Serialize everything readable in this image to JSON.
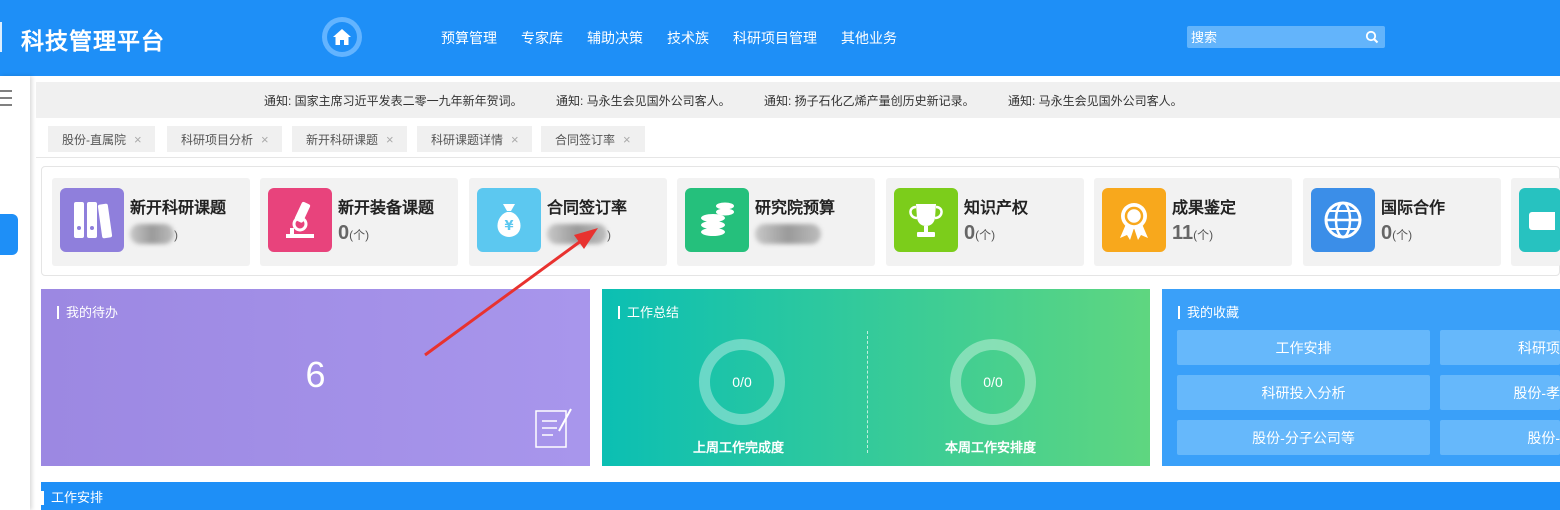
{
  "header": {
    "app_title": "科技管理平台",
    "nav": [
      "预算管理",
      "专家库",
      "辅助决策",
      "技术族",
      "科研项目管理",
      "其他业务"
    ],
    "search_placeholder": "搜索"
  },
  "notices": [
    "通知: 国家主席习近平发表二零一九年新年贺词。",
    "通知: 马永生会见国外公司客人。",
    "通知: 扬子石化乙烯产量创历史新记录。",
    "通知: 马永生会见国外公司客人。"
  ],
  "tabs": [
    "股份-直属院",
    "科研项目分析",
    "新开科研课题",
    "科研课题详情",
    "合同签订率"
  ],
  "modules": [
    {
      "title": "新开科研课题",
      "count": "",
      "unit": ")",
      "icon": "binders-icon",
      "color": "#8f7fdc"
    },
    {
      "title": "新开装备课题",
      "count": "0",
      "unit": "(个)",
      "icon": "microscope-icon",
      "color": "#e8437c"
    },
    {
      "title": "合同签订率",
      "count": "",
      "unit": ")",
      "icon": "money-bag-icon",
      "color": "#5cc8f0"
    },
    {
      "title": "研究院预算",
      "count": "",
      "unit": "",
      "icon": "coins-icon",
      "color": "#25c07c"
    },
    {
      "title": "知识产权",
      "count": "0",
      "unit": "(个)",
      "icon": "trophy-icon",
      "color": "#7ccd1b"
    },
    {
      "title": "成果鉴定",
      "count": "11",
      "unit": "(个)",
      "icon": "badge-icon",
      "color": "#f8a81c"
    },
    {
      "title": "国际合作",
      "count": "0",
      "unit": "(个)",
      "icon": "globe-icon",
      "color": "#3b8ee8"
    },
    {
      "title": "",
      "count": "",
      "unit": "",
      "icon": "book-icon",
      "color": "#27c2c0"
    }
  ],
  "todo": {
    "title": "我的待办",
    "count": "6"
  },
  "summary": {
    "title": "工作总结",
    "last_week": {
      "value": "0/0",
      "label": "上周工作完成度"
    },
    "this_week": {
      "value": "0/0",
      "label": "本周工作安排度"
    }
  },
  "favorites": {
    "title": "我的收藏",
    "items": [
      "工作安排",
      "科研项",
      "科研投入分析",
      "股份-孝",
      "股份-分子公司等",
      "股份-"
    ]
  },
  "work_bar": {
    "title": "工作安排"
  }
}
